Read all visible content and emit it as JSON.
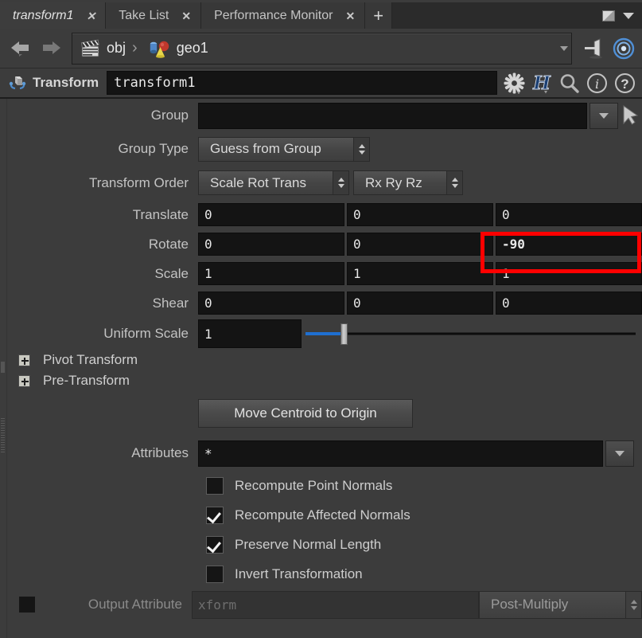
{
  "tabs": [
    {
      "label": "transform1",
      "close": "✕",
      "active": true
    },
    {
      "label": "Take List",
      "close": "✕",
      "active": false
    },
    {
      "label": "Performance Monitor",
      "close": "✕",
      "active": false
    }
  ],
  "tabbar": {
    "add_label": "+",
    "maximize_icon": "maximize-icon",
    "menu_icon": "chevron-down-icon"
  },
  "pathbar": {
    "back_icon": "back-arrow-icon",
    "forward_icon": "forward-arrow-icon",
    "crumbs": [
      {
        "icon": "clapperboard-icon",
        "label": "obj"
      },
      {
        "icon": "geometry-object-icon",
        "label": "geo1"
      }
    ],
    "separator": "›",
    "dropdown_icon": "chevron-down-icon",
    "pin_icon": "pin-icon",
    "target_icon": "target-icon"
  },
  "param_header": {
    "node_icon": "transform-node-icon",
    "title": "Transform",
    "node_name": "transform1",
    "icons": [
      {
        "name": "gear-icon",
        "glyph": "✻"
      },
      {
        "name": "houdini-h-icon",
        "glyph": "H"
      },
      {
        "name": "search-icon",
        "glyph": "⚲"
      },
      {
        "name": "info-icon",
        "glyph": "i"
      },
      {
        "name": "help-icon",
        "glyph": "?"
      }
    ]
  },
  "params": {
    "group": {
      "label": "Group",
      "value": "",
      "dropdown_icon": "chevron-down-icon",
      "picker_icon": "cursor-arrow-icon"
    },
    "group_type": {
      "label": "Group Type",
      "value": "Guess from Group"
    },
    "transform_order": {
      "label": "Transform Order",
      "value_a": "Scale Rot Trans",
      "value_b": "Rx Ry Rz"
    },
    "translate": {
      "label": "Translate",
      "x": "0",
      "y": "0",
      "z": "0"
    },
    "rotate": {
      "label": "Rotate",
      "x": "0",
      "y": "0",
      "z": "-90"
    },
    "scale": {
      "label": "Scale",
      "x": "1",
      "y": "1",
      "z": "1"
    },
    "shear": {
      "label": "Shear",
      "x": "0",
      "y": "0",
      "z": "0"
    },
    "uniform_scale": {
      "label": "Uniform Scale",
      "value": "1"
    },
    "pivot_transform": {
      "label": "Pivot Transform",
      "expand_icon": "plus-box-icon"
    },
    "pre_transform": {
      "label": "Pre-Transform",
      "expand_icon": "plus-box-icon"
    },
    "move_centroid": {
      "label": "Move Centroid to Origin"
    },
    "attributes": {
      "label": "Attributes",
      "value": "*",
      "dropdown_icon": "chevron-down-icon"
    },
    "checkboxes": [
      {
        "label": "Recompute Point Normals",
        "checked": false
      },
      {
        "label": "Recompute Affected Normals",
        "checked": true
      },
      {
        "label": "Preserve Normal Length",
        "checked": true
      },
      {
        "label": "Invert Transformation",
        "checked": false
      }
    ],
    "output_attribute": {
      "label": "Output Attribute",
      "enabled": false,
      "placeholder": "xform",
      "mode": "Post-Multiply"
    }
  },
  "highlight": {
    "name": "rotate-z-highlight",
    "color": "#ff0000"
  },
  "colors": {
    "panel_bg": "#3c3c3c",
    "tabbar_bg": "#2b2b2b",
    "field_bg": "#141414",
    "accent_blue": "#1f6fd0",
    "highlight_red": "#ff0000"
  }
}
